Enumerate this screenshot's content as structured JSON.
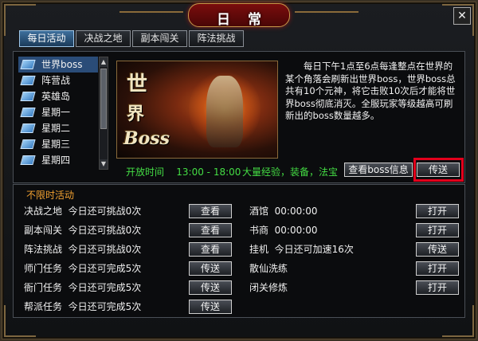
{
  "window": {
    "title": "日常"
  },
  "tabs": [
    {
      "label": "每日活动",
      "active": true
    },
    {
      "label": "决战之地",
      "active": false
    },
    {
      "label": "副本闯关",
      "active": false
    },
    {
      "label": "阵法挑战",
      "active": false
    }
  ],
  "daily_list": [
    {
      "label": "世界boss",
      "selected": true
    },
    {
      "label": "阵营战",
      "selected": false
    },
    {
      "label": "英雄岛",
      "selected": false
    },
    {
      "label": "星期一",
      "selected": false
    },
    {
      "label": "星期二",
      "selected": false
    },
    {
      "label": "星期三",
      "selected": false
    },
    {
      "label": "星期四",
      "selected": false
    }
  ],
  "scroll": {
    "up": "▲",
    "down": "▼"
  },
  "detail": {
    "banner_glyph_1": "世",
    "banner_glyph_2": "界",
    "banner_glyph_3": "Boss",
    "description": "每日下午1点至6点每逢整点在世界的某个角落会刷新出世界boss，世界boss总共有10个元神，将它击败10次后才能将世界boss彻底消灭。全服玩家等级越高可刷新出的boss数量越多。",
    "open_time_label": "开放时间",
    "open_time": "13:00 - 18:00",
    "reward": "大量经验，装备，法宝",
    "view_boss_button": "查看boss信息",
    "teleport_button": "传送"
  },
  "unlimited": {
    "title": "不限时活动",
    "left": [
      {
        "name": "决战之地",
        "status": "今日还可挑战0次",
        "button": "查看"
      },
      {
        "name": "副本闯关",
        "status": "今日还可挑战0次",
        "button": "查看"
      },
      {
        "name": "阵法挑战",
        "status": "今日还可挑战0次",
        "button": "查看"
      },
      {
        "name": "师门任务",
        "status": "今日还可完成5次",
        "button": "传送"
      },
      {
        "name": "衙门任务",
        "status": "今日还可完成5次",
        "button": "传送"
      },
      {
        "name": "帮派任务",
        "status": "今日还可完成5次",
        "button": "传送"
      }
    ],
    "right": [
      {
        "name": "酒馆",
        "status": "00:00:00",
        "button": "打开"
      },
      {
        "name": "书商",
        "status": "00:00:00",
        "button": "打开"
      },
      {
        "name": "挂机",
        "status": "今日还可加速16次",
        "button": "传送"
      },
      {
        "name": "散仙洗练",
        "status": "",
        "button": "打开"
      },
      {
        "name": "闭关修炼",
        "status": "",
        "button": "打开"
      }
    ]
  },
  "close": "✕",
  "colors": {
    "accent_green": "#44dd44",
    "section_orange": "#f0a030",
    "highlight_red": "#e3001b",
    "tab_active": "#2a4c78"
  }
}
